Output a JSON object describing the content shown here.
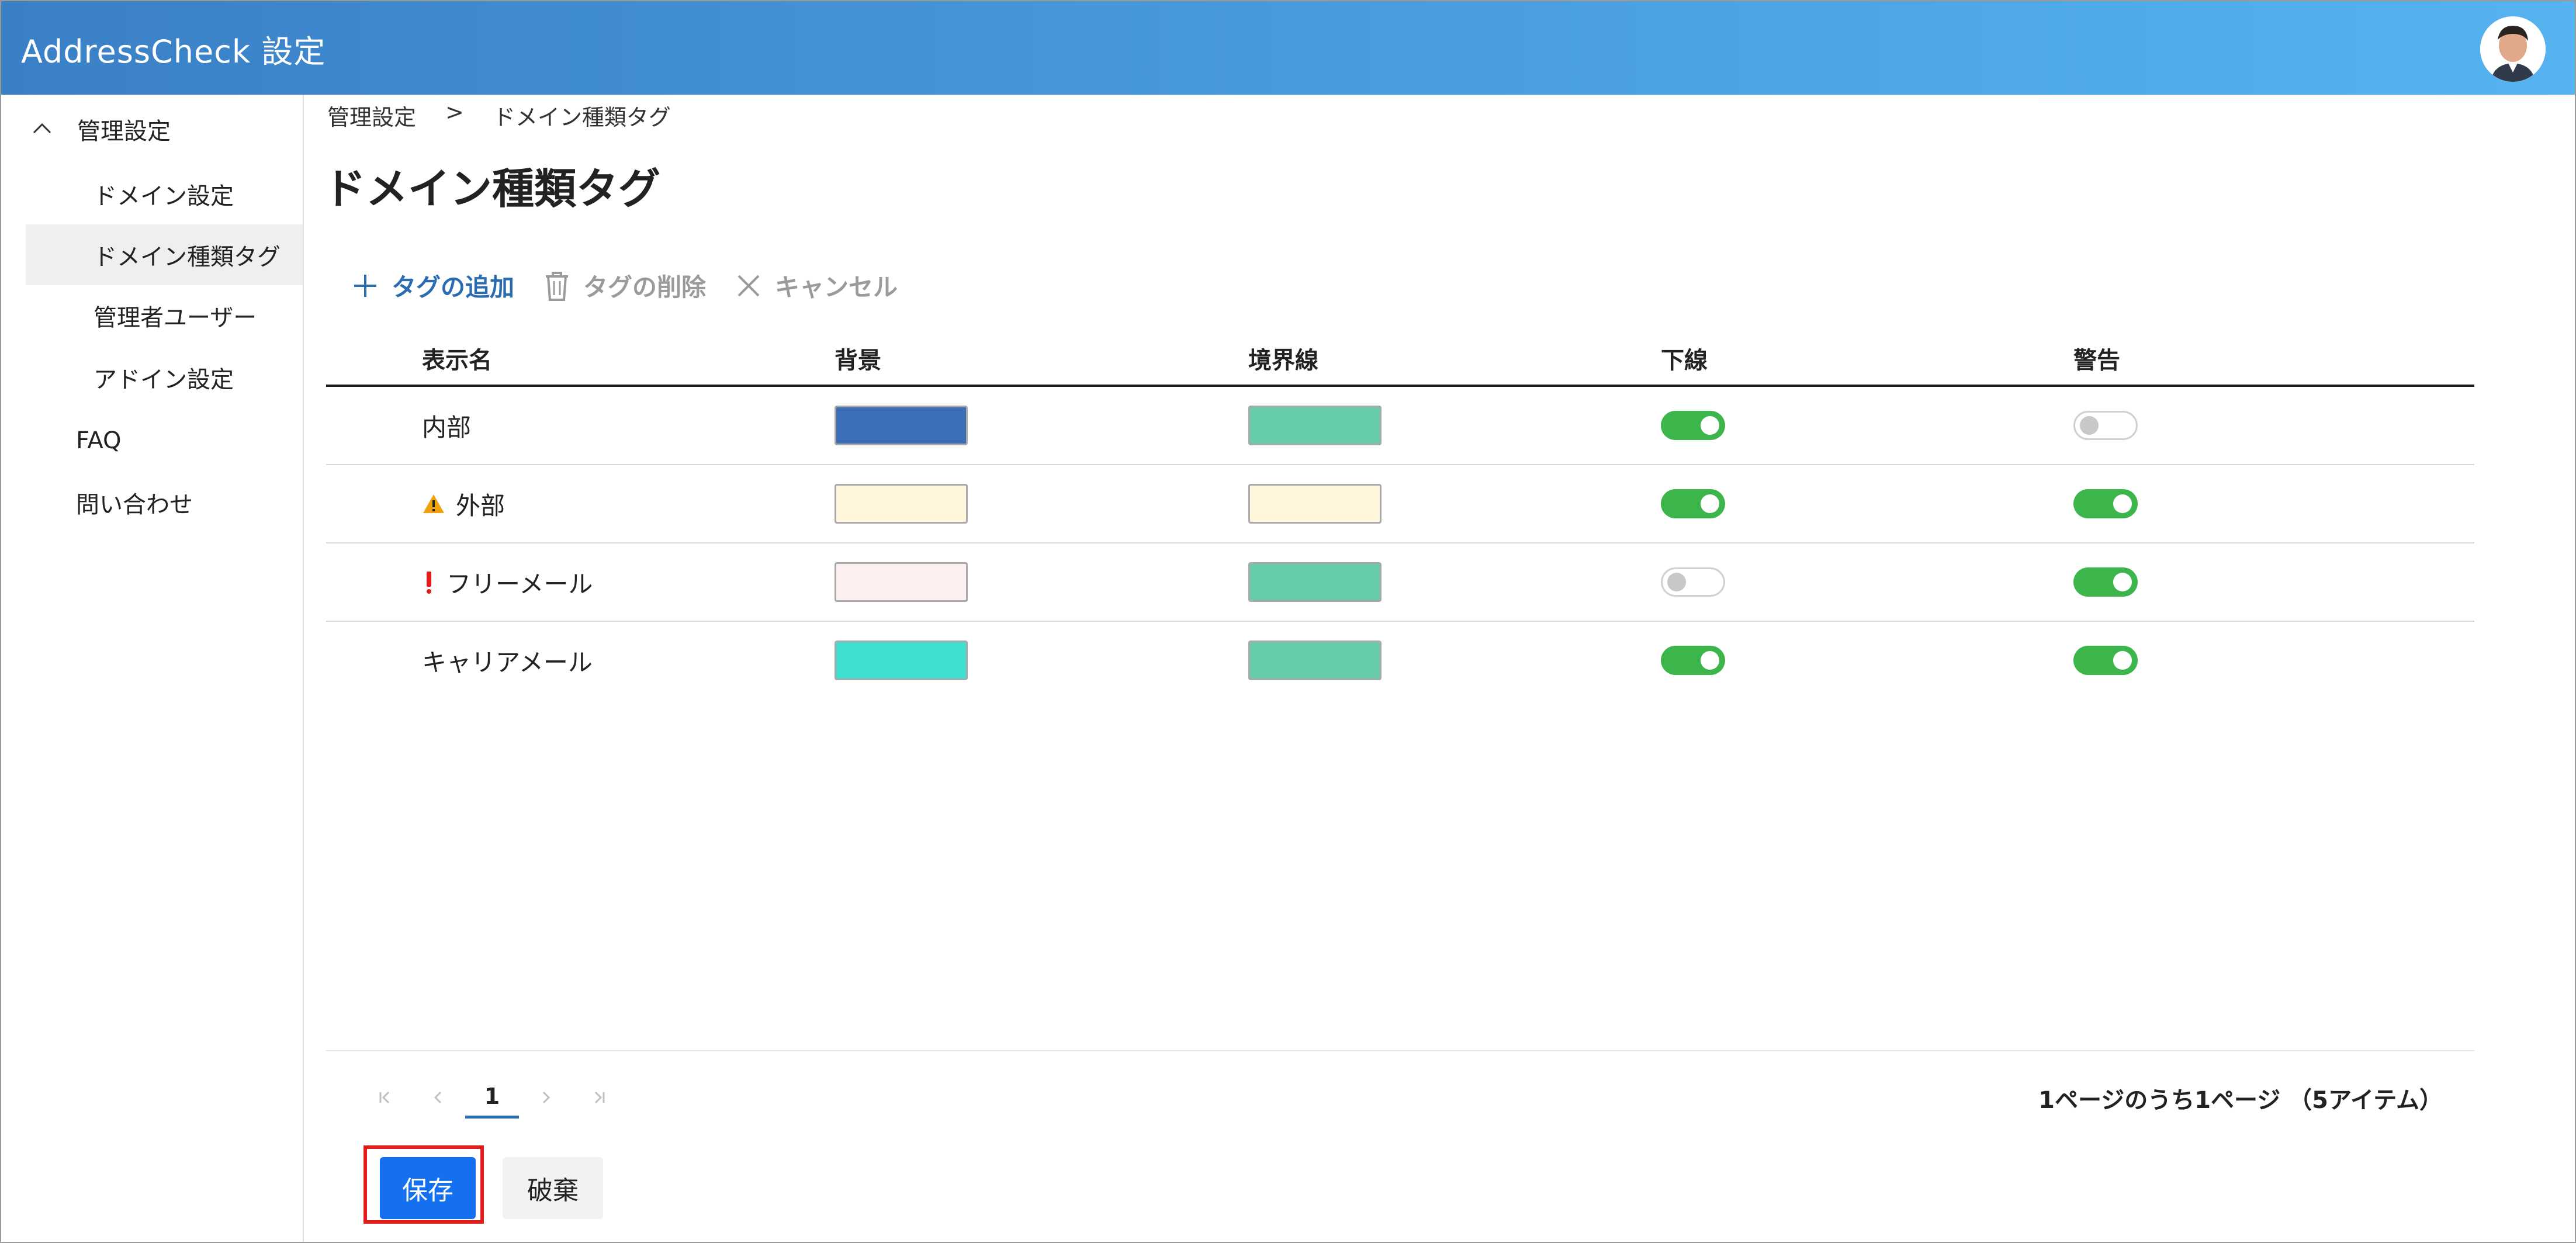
{
  "app": {
    "title": "AddressCheck 設定"
  },
  "sidebar": {
    "group_label": "管理設定",
    "items": [
      {
        "label": "ドメイン設定"
      },
      {
        "label": "ドメイン種類タグ",
        "active": true
      },
      {
        "label": "管理者ユーザー"
      },
      {
        "label": "アドイン設定"
      },
      {
        "label": "FAQ"
      },
      {
        "label": "問い合わせ"
      }
    ]
  },
  "breadcrumb": {
    "parent": "管理設定",
    "separator": ">",
    "current": "ドメイン種類タグ"
  },
  "page": {
    "title": "ドメイン種類タグ"
  },
  "toolbar": {
    "add_label": "タグの追加",
    "delete_label": "タグの削除",
    "cancel_label": "キャンセル"
  },
  "table": {
    "headers": [
      "表示名",
      "背景",
      "境界線",
      "下線",
      "警告"
    ],
    "rows": [
      {
        "name": "内部",
        "icon": "",
        "background": "#3d6fb6",
        "border": "#66cda8",
        "underline": true,
        "warning": false
      },
      {
        "name": "外部",
        "icon": "warning-triangle-icon",
        "background": "#fff6dc",
        "border": "#fff6dc",
        "underline": true,
        "warning": true
      },
      {
        "name": "フリーメール",
        "icon": "exclamation-icon",
        "background": "#fdf0f0",
        "border": "#66cda8",
        "underline": false,
        "warning": true
      },
      {
        "name": "キャリアメール",
        "icon": "",
        "background": "#3fe0cf",
        "border": "#66cda8",
        "underline": true,
        "warning": true
      }
    ]
  },
  "pagination": {
    "current_page": "1",
    "info": "1ページのうち1ページ （5アイテム）"
  },
  "actions": {
    "save_label": "保存",
    "discard_label": "破棄"
  },
  "colors": {
    "accent": "#1570ef",
    "toggle_on": "#3cb54a",
    "highlight_border": "#e31b1b"
  }
}
